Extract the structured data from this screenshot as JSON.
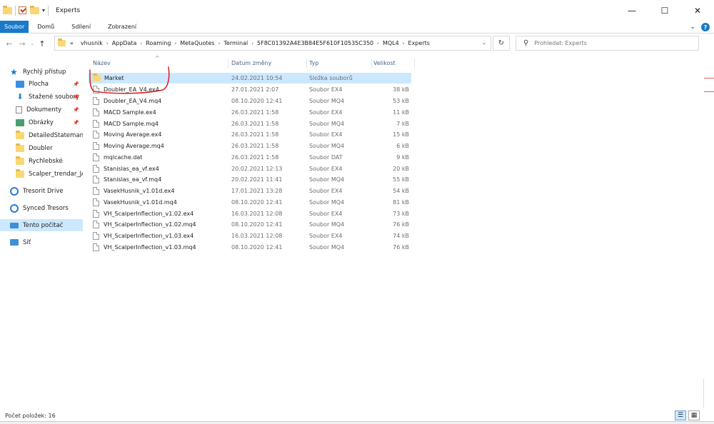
{
  "window": {
    "title": "Experts",
    "minimize": "—",
    "maximize": "☐",
    "close": "✕"
  },
  "ribbon": {
    "tabs": [
      {
        "label": "Soubor"
      },
      {
        "label": "Domů"
      },
      {
        "label": "Sdílení"
      },
      {
        "label": "Zobrazení"
      }
    ],
    "help": "?"
  },
  "address": {
    "prefix": "«",
    "crumbs": [
      "vhusnik",
      "AppData",
      "Roaming",
      "MetaQuotes",
      "Terminal",
      "5F8C01392A4E3B84E5F610F10535C350",
      "MQL4",
      "Experts"
    ]
  },
  "search": {
    "placeholder": "Prohledat: Experts"
  },
  "sidebar": {
    "items": [
      {
        "label": "Rychlý přístup",
        "icon": "star-icon"
      },
      {
        "label": "Plocha",
        "icon": "desktop-icon",
        "pinned": true
      },
      {
        "label": "Stažené soubory",
        "icon": "download-icon",
        "pinned": true
      },
      {
        "label": "Dokumenty",
        "icon": "document-icon",
        "pinned": true
      },
      {
        "label": "Obrázky",
        "icon": "pictures-icon",
        "pinned": true
      },
      {
        "label": "DetailedStatemant",
        "icon": "folder-icon"
      },
      {
        "label": "Doubler",
        "icon": "folder-icon"
      },
      {
        "label": "Rychlebské",
        "icon": "folder-icon"
      },
      {
        "label": "Scalper_trendar_JArr",
        "icon": "folder-icon"
      },
      {
        "label": "Tresorit Drive",
        "icon": "tresorit-icon"
      },
      {
        "label": "Synced Tresors",
        "icon": "tresorit-icon"
      },
      {
        "label": "Tento počítač",
        "icon": "computer-icon",
        "selected": true
      },
      {
        "label": "Síť",
        "icon": "network-icon"
      }
    ]
  },
  "columns": [
    "Název",
    "Datum změny",
    "Typ",
    "Velikost"
  ],
  "files": [
    {
      "name": "Market",
      "date": "24.02.2021 10:54",
      "type": "Složka souborů",
      "size": "",
      "folder": true
    },
    {
      "name": "Doubler_EA_V4.ex4",
      "date": "27.01.2021 2:07",
      "type": "Soubor EX4",
      "size": "38 kB"
    },
    {
      "name": "Doubler_EA_V4.mq4",
      "date": "08.10.2020 12:41",
      "type": "Soubor MQ4",
      "size": "53 kB"
    },
    {
      "name": "MACD Sample.ex4",
      "date": "26.03.2021 1:58",
      "type": "Soubor EX4",
      "size": "11 kB"
    },
    {
      "name": "MACD Sample.mq4",
      "date": "26.03.2021 1:58",
      "type": "Soubor MQ4",
      "size": "7 kB"
    },
    {
      "name": "Moving Average.ex4",
      "date": "26.03.2021 1:58",
      "type": "Soubor EX4",
      "size": "15 kB"
    },
    {
      "name": "Moving Average.mq4",
      "date": "26.03.2021 1:58",
      "type": "Soubor MQ4",
      "size": "6 kB"
    },
    {
      "name": "mqlcache.dat",
      "date": "26.03.2021 1:58",
      "type": "Soubor DAT",
      "size": "9 kB"
    },
    {
      "name": "Stanislas_ea_vf.ex4",
      "date": "20.02.2021 12:13",
      "type": "Soubor EX4",
      "size": "20 kB"
    },
    {
      "name": "Stanislas_ea_vf.mq4",
      "date": "20.02.2021 11:41",
      "type": "Soubor MQ4",
      "size": "55 kB"
    },
    {
      "name": "VasekHusnik_v1.01d.ex4",
      "date": "17.01.2021 13:28",
      "type": "Soubor EX4",
      "size": "54 kB"
    },
    {
      "name": "VasekHusnik_v1.01d.mq4",
      "date": "08.10.2020 12:41",
      "type": "Soubor MQ4",
      "size": "81 kB"
    },
    {
      "name": "VH_ScalperInflection_v1.02.ex4",
      "date": "16.03.2021 12:08",
      "type": "Soubor EX4",
      "size": "73 kB"
    },
    {
      "name": "VH_ScalperInflection_v1.02.mq4",
      "date": "08.10.2020 12:41",
      "type": "Soubor MQ4",
      "size": "76 kB"
    },
    {
      "name": "VH_ScalperInflection_v1.03.ex4",
      "date": "16.03.2021 12:08",
      "type": "Soubor EX4",
      "size": "74 kB"
    },
    {
      "name": "VH_ScalperInflection_v1.03.mq4",
      "date": "08.10.2020 12:41",
      "type": "Soubor MQ4",
      "size": "76 kB"
    }
  ],
  "status": {
    "count": "Počet položek: 16"
  },
  "colors": {
    "accent": "#1979ca",
    "selection": "#cce8ff",
    "annotation": "#d8262c"
  }
}
